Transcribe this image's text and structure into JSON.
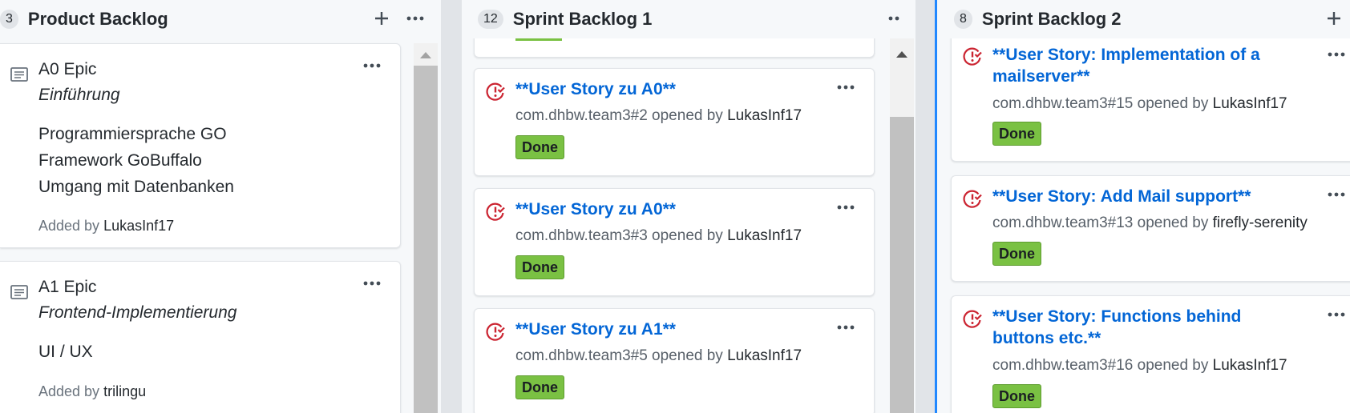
{
  "columns": [
    {
      "count": "3",
      "title": "Product Backlog",
      "cards": [
        {
          "title": "A0 Epic",
          "subtitle": "Einführung",
          "lines": [
            "Programmiersprache GO",
            "Framework GoBuffalo",
            "Umgang mit Datenbanken"
          ],
          "added_prefix": "Added by",
          "added_by": "LukasInf17"
        },
        {
          "title": "A1 Epic",
          "subtitle": "Frontend-Implementierung",
          "lines": [
            "UI / UX"
          ],
          "added_prefix": "Added by",
          "added_by": "trilingu"
        }
      ]
    },
    {
      "count": "12",
      "title": "Sprint Backlog 1",
      "cards": [
        {
          "title": "**User Story zu A0**",
          "ref": "com.dhbw.team3#2",
          "opened_prefix": "opened by",
          "author": "LukasInf17",
          "label": "Done"
        },
        {
          "title": "**User Story zu A0**",
          "ref": "com.dhbw.team3#3",
          "opened_prefix": "opened by",
          "author": "LukasInf17",
          "label": "Done"
        },
        {
          "title": "**User Story zu A1**",
          "ref": "com.dhbw.team3#5",
          "opened_prefix": "opened by",
          "author": "LukasInf17",
          "label": "Done"
        }
      ]
    },
    {
      "count": "8",
      "title": "Sprint Backlog 2",
      "cards": [
        {
          "title": "**User Story: Implementation of a mailserver**",
          "ref": "com.dhbw.team3#15",
          "opened_prefix": "opened by",
          "author": "LukasInf17",
          "label": "Done"
        },
        {
          "title": "**User Story: Add Mail support**",
          "ref": "com.dhbw.team3#13",
          "opened_prefix": "opened by",
          "author": "firefly-serenity",
          "label": "Done"
        },
        {
          "title": "**User Story: Functions behind buttons etc.**",
          "ref": "com.dhbw.team3#16",
          "opened_prefix": "opened by",
          "author": "LukasInf17",
          "label": "Done"
        }
      ]
    }
  ],
  "icons": {
    "add": "plus-icon",
    "menu": "kebab-horizontal-icon",
    "note": "note-icon",
    "issue": "issue-closed-icon"
  },
  "colors": {
    "link": "#0366d6",
    "done_label": "#7ac143",
    "issue_closed": "#cb2431",
    "column_bg": "#f6f8fa"
  }
}
